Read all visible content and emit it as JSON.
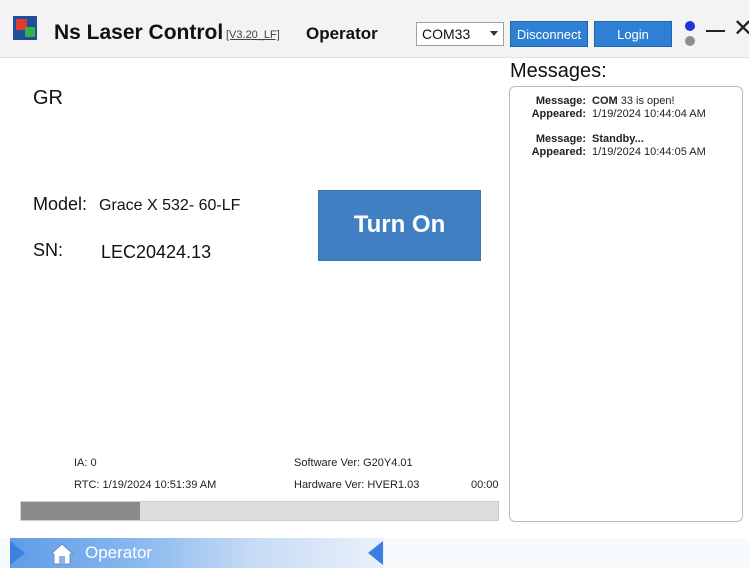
{
  "titlebar": {
    "app_title": "Ns Laser Control",
    "version": "[V3.20_LF]",
    "mode": "Operator",
    "com_port": "COM33",
    "disconnect_label": "Disconnect",
    "login_label": "Login",
    "close_glyph": "✕"
  },
  "main": {
    "section_label": "GR",
    "model_label": "Model:",
    "model_value": "Grace X 532- 60-LF",
    "sn_label": "SN:",
    "sn_value": "LEC20424.13",
    "turn_on_label": "Turn On",
    "ia_text": "IA:   0",
    "rtc_text": "RTC: 1/19/2024 10:51:39 AM",
    "software_text": "Software Ver:   G20Y4.01",
    "hardware_text": "Hardware Ver:  HVER1.03",
    "elapsed_time": "00:00",
    "progress_fraction": 0.25
  },
  "messages": {
    "title": "Messages:",
    "message_key": "Message:",
    "appeared_key": "Appeared:",
    "items": [
      {
        "message_bold": "COM",
        "message_rest": "33 is open!",
        "appeared": "1/19/2024 10:44:04 AM"
      },
      {
        "message_bold": "Standby...",
        "message_rest": "",
        "appeared": "1/19/2024 10:44:05 AM"
      }
    ]
  },
  "bottom_nav": {
    "label": "Operator",
    "icon": "home-icon"
  },
  "colors": {
    "button_blue": "#2f80d4",
    "turn_on_blue": "#3f7fc2",
    "status_dot_blue": "#1a34e0",
    "status_dot_gray": "#8d8d8d"
  }
}
